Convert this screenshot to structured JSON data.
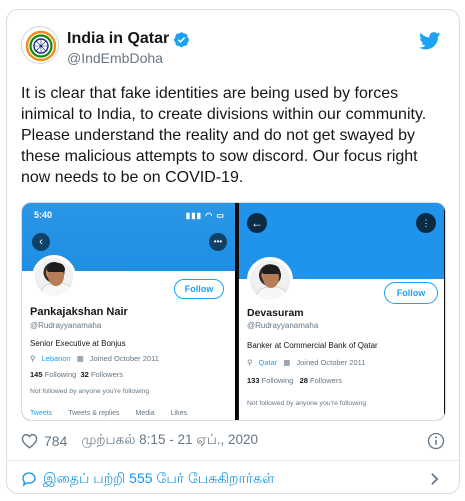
{
  "tweet": {
    "author_name": "India in Qatar",
    "author_handle": "@IndEmbDoha",
    "text": "It is clear that fake identities are being used by forces inimical to India, to create divisions within our community. Please understand the reality and do not get swayed by these malicious attempts to sow discord. Our focus right now needs to be on COVID-19.",
    "likes": "784",
    "timestamp": "முற்பகல் 8:15 - 21 ஏப்., 2020",
    "replies_text": "இதைப் பற்றி 555 பேர் பேசுகிறார்கள்"
  },
  "media": {
    "left_profile": {
      "status_time": "5:40",
      "status_icons": "▮▮▮ ◠ ▭",
      "follow_label": "Follow",
      "name": "Pankajakshan Nair",
      "handle": "@Rudrayyanamaha",
      "bio": "Senior Executive at Bonjus",
      "location": "Lebanon",
      "joined": "Joined October 2011",
      "following_count": "145",
      "following_label": "Following",
      "followers_count": "32",
      "followers_label": "Followers",
      "note": "Not followed by anyone you're following",
      "tabs": [
        "Tweets",
        "Tweets & replies",
        "Media",
        "Likes"
      ]
    },
    "right_profile": {
      "follow_label": "Follow",
      "name": "Devasuram",
      "handle": "@Rudrayyanamaha",
      "bio": "Banker at Commercial Bank of Qatar",
      "location": "Qatar",
      "joined": "Joined October 2011",
      "following_count": "133",
      "following_label": "Following",
      "followers_count": "28",
      "followers_label": "Followers",
      "note": "Not followed by anyone you're following"
    }
  },
  "colors": {
    "twitter_blue": "#1da1f2",
    "reply_blue": "#1b95e0",
    "text": "#14171a",
    "muted": "#657786"
  },
  "icons": {
    "verified": "verified-badge-icon",
    "brand": "twitter-bird-icon",
    "like": "heart-icon",
    "info": "info-icon",
    "replies": "speech-bubble-icon",
    "more": "chevron-right-icon"
  }
}
